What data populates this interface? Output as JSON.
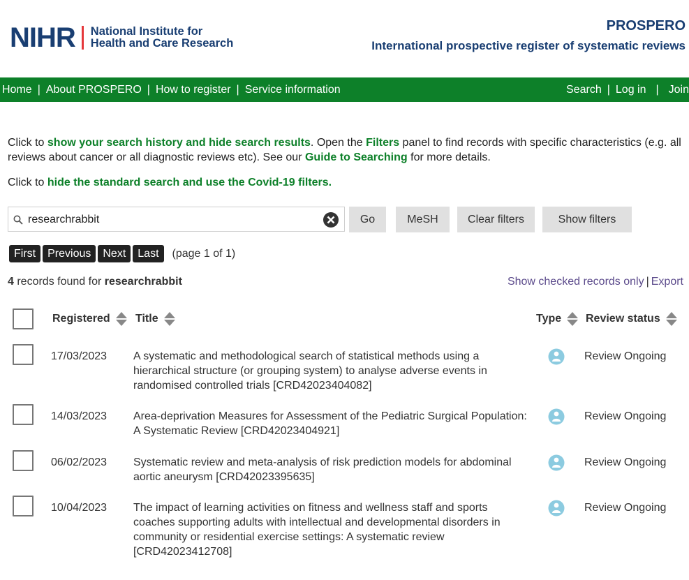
{
  "header": {
    "logo_mark": "NIHR",
    "logo_line1": "National Institute for",
    "logo_line2": "Health and Care Research",
    "title": "PROSPERO",
    "subtitle": "International prospective register of systematic reviews"
  },
  "nav": {
    "left": [
      "Home",
      "About PROSPERO",
      "How to register",
      "Service information"
    ],
    "right": [
      "Search",
      "Log in",
      "Join"
    ],
    "separator": "|"
  },
  "info": {
    "p1_a": "Click to ",
    "p1_link": "show your search history and hide search results",
    "p1_b": ". Open the ",
    "p1_filters": "Filters",
    "p1_c": " panel to find records with specific characteristics (e.g. all reviews about cancer or all diagnostic reviews etc). See our ",
    "p1_guide": "Guide to Searching",
    "p1_d": " for more details.",
    "p2_a": "Click to ",
    "p2_link": "hide the standard search and use the Covid-19 filters."
  },
  "search": {
    "value": "researchrabbit",
    "go": "Go",
    "mesh": "MeSH",
    "clear_filters": "Clear filters",
    "show_filters": "Show filters"
  },
  "pager": {
    "first": "First",
    "previous": "Previous",
    "next": "Next",
    "last": "Last",
    "info": "(page 1 of 1)"
  },
  "results": {
    "count": "4",
    "found_text": " records found for ",
    "query": "researchrabbit",
    "show_checked": "Show checked records only",
    "tools_sep": "|",
    "export": "Export"
  },
  "columns": {
    "registered": "Registered",
    "title": "Title",
    "type": "Type",
    "status": "Review status"
  },
  "rows": [
    {
      "date": "17/03/2023",
      "title": "A systematic and methodological search of statistical methods using a hierarchical structure (or grouping system) to analyse adverse events in randomised controlled trials [CRD42023404082]",
      "status": "Review Ongoing"
    },
    {
      "date": "14/03/2023",
      "title": "Area-deprivation Measures for Assessment of the Pediatric Surgical Population: A Systematic Review [CRD42023404921]",
      "status": "Review Ongoing"
    },
    {
      "date": "06/02/2023",
      "title": "Systematic review and meta-analysis of risk prediction models for abdominal aortic aneurysm [CRD42023395635]",
      "status": "Review Ongoing"
    },
    {
      "date": "10/04/2023",
      "title": "The impact of learning activities on fitness and wellness staff and sports coaches supporting adults with intellectual and developmental disorders in community or residential exercise settings: A systematic review [CRD42023412708]",
      "status": "Review Ongoing"
    }
  ],
  "icons": {
    "type": "person-icon",
    "search": "search-icon",
    "clear": "clear-icon"
  },
  "colors": {
    "brand_navy": "#193e72",
    "nav_green": "#0d8029",
    "logo_red": "#e5383b",
    "link_purple": "#5b4a8b",
    "type_icon": "#8ccbe0"
  }
}
